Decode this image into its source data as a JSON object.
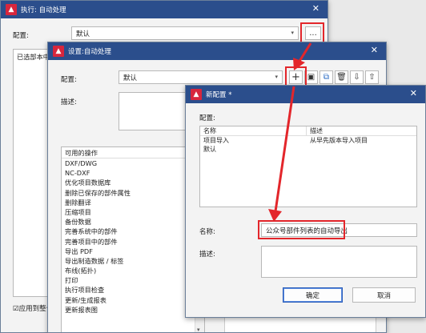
{
  "win1": {
    "title": "执行: 自动处理",
    "config_label": "配置:",
    "config_value": "默认",
    "more_button": "...",
    "partial_text": "已选部本中",
    "apply_checkbox": "☑应用到整个"
  },
  "win2": {
    "title": "设置:自动处理",
    "config_label": "配置:",
    "config_value": "默认",
    "desc_label": "描述:",
    "ops_header": "可用的操作",
    "operations": [
      "DXF/DWG",
      "NC-DXF",
      "优化项目数据库",
      "删除已保存的部件属性",
      "删除翻译",
      "压缩项目",
      "备份数据",
      "完善系统中的部件",
      "完善项目中的部件",
      "导出 PDF",
      "导出制造数据 / 标签",
      "布线(拓扑)",
      "打印",
      "执行项目检查",
      "更新/生成报表",
      "更新报表图"
    ]
  },
  "win3": {
    "title": "新配置 *",
    "config_label": "配置:",
    "col_name": "名称",
    "col_desc": "描述",
    "rows": [
      {
        "name": "项目导入",
        "desc": "从早先版本导入项目"
      },
      {
        "name": "默认",
        "desc": ""
      }
    ],
    "name_label": "名称:",
    "name_value": "公众号部件列表的自动导出",
    "desc_label": "描述:",
    "ok_button": "确定",
    "cancel_button": "取消"
  },
  "colors": {
    "titlebar": "#2b4e8c",
    "highlight": "#e3262b"
  }
}
